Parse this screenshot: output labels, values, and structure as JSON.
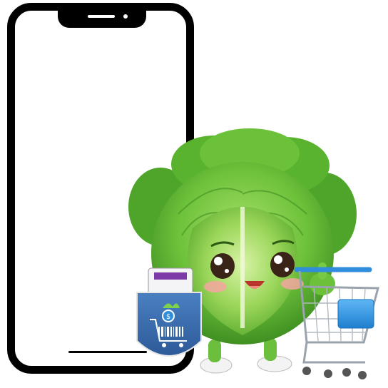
{
  "scene": {
    "colors": {
      "phone_frame": "#000000",
      "screen": "#ffffff",
      "cabbage_light": "#8ed14b",
      "cabbage_mid": "#5fb432",
      "cabbage_dark": "#3c8a1f",
      "blush": "#f4a6a0",
      "bag_blue": "#3d6fb0",
      "cart_blue": "#2f8ddb",
      "cart_metal": "#9aa3ad"
    },
    "icons": [
      "phone-mockup",
      "cabbage-mascot",
      "shopping-bag-icon",
      "shopping-cart-icon",
      "dollar-coin-icon",
      "barcode-icon"
    ]
  }
}
